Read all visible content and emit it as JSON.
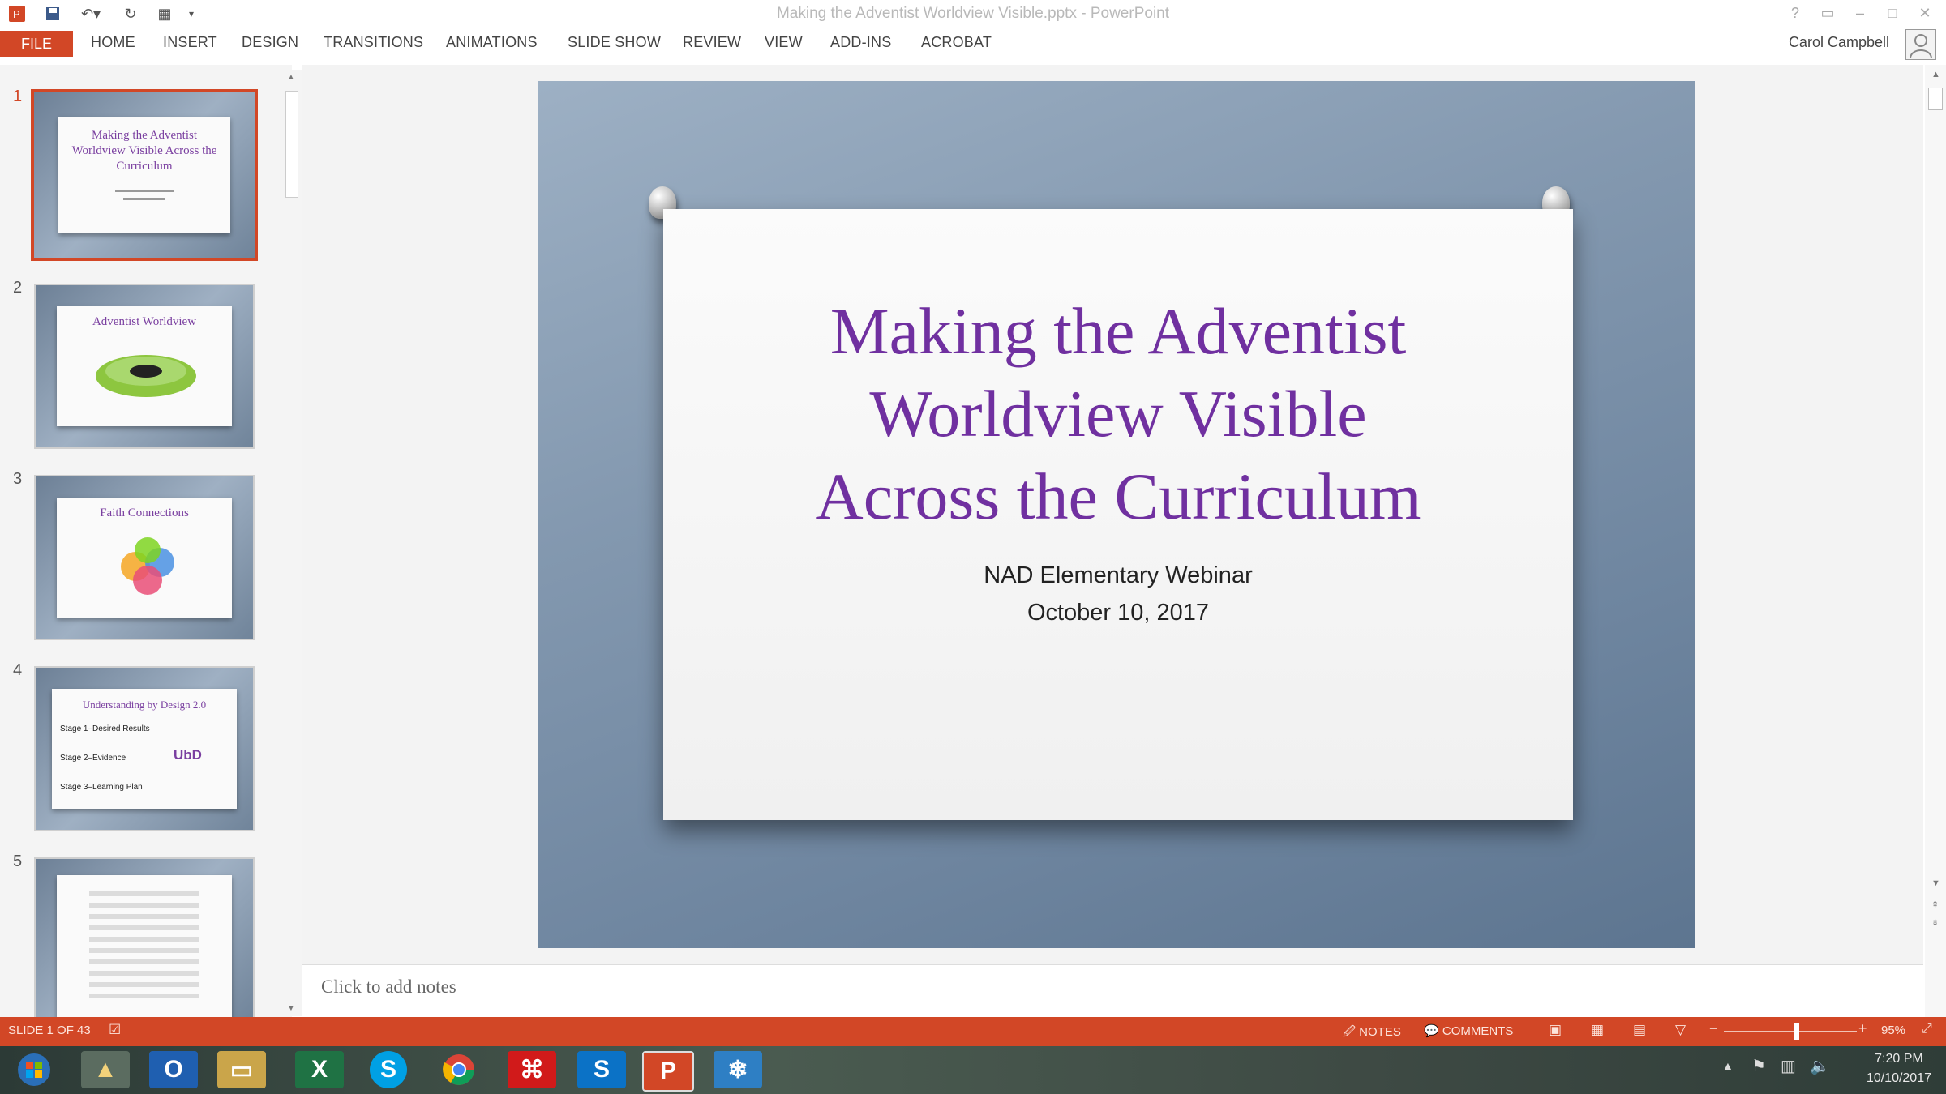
{
  "window": {
    "title": "Making the Adventist Worldview Visible.pptx - PowerPoint"
  },
  "ribbon": {
    "file": "FILE",
    "tabs": [
      "HOME",
      "INSERT",
      "DESIGN",
      "TRANSITIONS",
      "ANIMATIONS",
      "SLIDE SHOW",
      "REVIEW",
      "VIEW",
      "ADD-INS",
      "ACROBAT"
    ],
    "user": "Carol Campbell"
  },
  "thumbnails": [
    {
      "number": "1",
      "title": "Making the Adventist Worldview Visible Across the Curriculum"
    },
    {
      "number": "2",
      "title": "Adventist Worldview"
    },
    {
      "number": "3",
      "title": "Faith Connections"
    },
    {
      "number": "4",
      "title": "Understanding by Design 2.0",
      "bullets": [
        "Stage 1–Desired Results",
        "Stage 2–Evidence",
        "Stage 3–Learning Plan"
      ],
      "logo": "UbD"
    },
    {
      "number": "5",
      "title": ""
    }
  ],
  "slide": {
    "title": "Making the Adventist Worldview Visible Across the Curriculum",
    "subtitle_line1": "NAD Elementary Webinar",
    "subtitle_line2": "October 10, 2017"
  },
  "notes": {
    "placeholder": "Click to add notes"
  },
  "statusbar": {
    "slide_info": "SLIDE 1 OF 43",
    "notes": "NOTES",
    "comments": "COMMENTS",
    "zoom": "95%",
    "zoom_level": 0.55
  },
  "taskbar": {
    "time": "7:20 PM",
    "date": "10/10/2017"
  },
  "colors": {
    "accent": "#d24726",
    "title_purple": "#7030a0"
  }
}
